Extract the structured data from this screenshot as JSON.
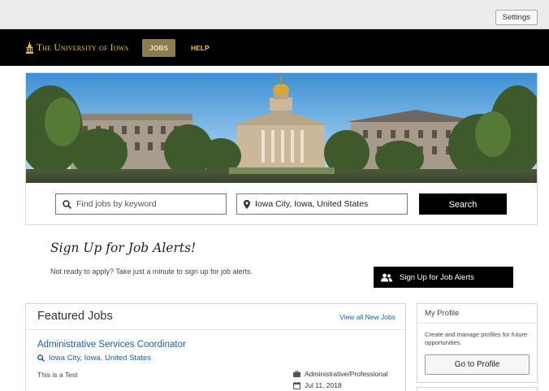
{
  "topbar": {
    "settings_label": "Settings"
  },
  "nav": {
    "logo_text": "The University of Iowa",
    "items": [
      {
        "label": "JOBS",
        "active": true
      },
      {
        "label": "HELP",
        "active": false
      }
    ]
  },
  "search": {
    "keyword_placeholder": "Find jobs by keyword",
    "location_value": "Iowa City, Iowa, United States",
    "button_label": "Search"
  },
  "alerts": {
    "title": "Sign Up for Job Alerts!",
    "text": "Not ready to apply? Take just a minute to sign up for job alerts.",
    "button_label": "Sign Up for Job Alerts"
  },
  "featured": {
    "title": "Featured Jobs",
    "view_all_label": "View all New Jobs",
    "job": {
      "title": "Administrative Services Coordinator",
      "location": "Iowa City, Iowa, United States",
      "description": "This is a Test",
      "category": "Administrative/Professional",
      "date": "Jul 11, 2018"
    }
  },
  "profile": {
    "title": "My Profile",
    "text": "Create and manage profiles for future opportunities.",
    "button_label": "Go to Profile"
  },
  "colors": {
    "brand_gold": "#f0c040",
    "nav_background": "#000000",
    "link_blue": "#1a5fa8"
  }
}
